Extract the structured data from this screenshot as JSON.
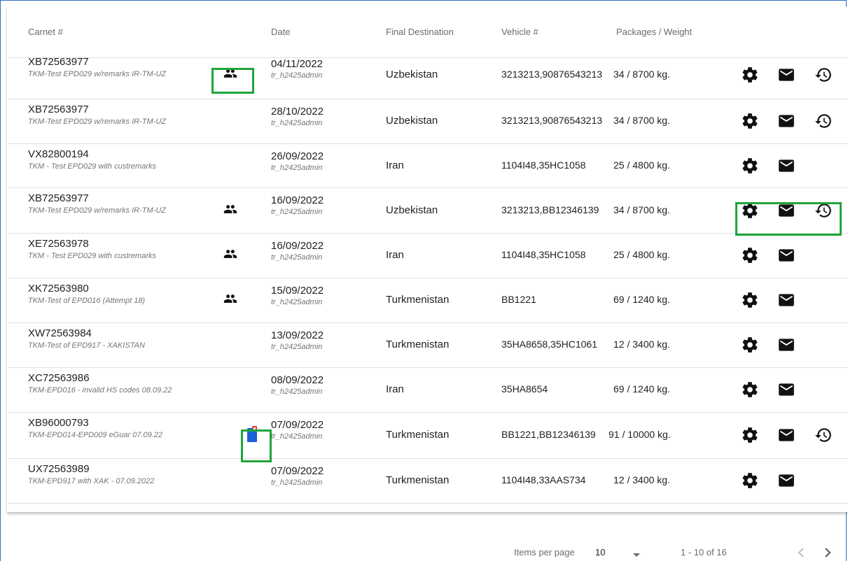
{
  "headers": {
    "carnet": "Carnet #",
    "date": "Date",
    "destination": "Final Destination",
    "vehicle": "Vehicle #",
    "packages": "Packages / Weight"
  },
  "rows": [
    {
      "carnet": "XB72563977",
      "remarks": "TKM-Test EPD029 w/remarks IR-TM-UZ",
      "date": "04/11/2022",
      "user": "tr_h2425admin",
      "destination": "Uzbekistan",
      "vehicle": "3213213,90876543213",
      "packages": "34 / 8700 kg.",
      "badge": "group-icon",
      "history": true
    },
    {
      "carnet": "XB72563977",
      "remarks": "TKM-Test EPD029 w/remarks IR-TM-UZ",
      "date": "28/10/2022",
      "user": "tr_h2425admin",
      "destination": "Uzbekistan",
      "vehicle": "3213213,90876543213",
      "packages": "34 / 8700 kg.",
      "badge": "",
      "history": true
    },
    {
      "carnet": "VX82800194",
      "remarks": "TKM - Test EPD029 with custremarks",
      "date": "26/09/2022",
      "user": "tr_h2425admin",
      "destination": "Iran",
      "vehicle": "1104I48,35HC1058",
      "packages": "25 / 4800 kg.",
      "badge": "",
      "history": false
    },
    {
      "carnet": "XB72563977",
      "remarks": "TKM-Test EPD029 w/remarks IR-TM-UZ",
      "date": "16/09/2022",
      "user": "tr_h2425admin",
      "destination": "Uzbekistan",
      "vehicle": "3213213,BB12346139",
      "packages": "34 / 8700 kg.",
      "badge": "group-icon",
      "history": true
    },
    {
      "carnet": "XE72563978",
      "remarks": "TKM - Test EPD029 with custremarks",
      "date": "16/09/2022",
      "user": "tr_h2425admin",
      "destination": "Iran",
      "vehicle": "1104I48,35HC1058",
      "packages": "25 / 4800 kg.",
      "badge": "group-icon",
      "history": false
    },
    {
      "carnet": "XK72563980",
      "remarks": "TKM-Test of EPD016 (Attempt 18)",
      "date": "15/09/2022",
      "user": "tr_h2425admin",
      "destination": "Turkmenistan",
      "vehicle": "BB1221",
      "packages": "69 / 1240 kg.",
      "badge": "group-icon",
      "history": false
    },
    {
      "carnet": "XW72563984",
      "remarks": "TKM-Test of EPD917 - XAKISTAN",
      "date": "13/09/2022",
      "user": "tr_h2425admin",
      "destination": "Turkmenistan",
      "vehicle": "35HA8658,35HC1061",
      "packages": "12 / 3400 kg.",
      "badge": "",
      "history": false
    },
    {
      "carnet": "XC72563986",
      "remarks": "TKM-EPD016 - invalid HS codes 08.09.22",
      "date": "08/09/2022",
      "user": "tr_h2425admin",
      "destination": "Iran",
      "vehicle": "35HA8654",
      "packages": "69 / 1240 kg.",
      "badge": "",
      "history": false
    },
    {
      "carnet": "XB96000793",
      "remarks": "TKM-EPD014-EPD009 eGuar 07.09.22",
      "date": "07/09/2022",
      "user": "tr_h2425admin",
      "destination": "Turkmenistan",
      "vehicle": "BB1221,BB12346139",
      "packages": "91 / 10000 kg.",
      "badge": "document-icon",
      "history": true
    },
    {
      "carnet": "UX72563989",
      "remarks": "TKM-EPD917 with XAK - 07.09.2022",
      "date": "07/09/2022",
      "user": "tr_h2425admin",
      "destination": "Turkmenistan",
      "vehicle": "1104I48,33AAS734",
      "packages": "12 / 3400 kg.",
      "badge": "",
      "history": false
    }
  ],
  "pagination": {
    "items_per_page_label": "Items per page",
    "items_per_page_value": "10",
    "range": "1 - 10 of 16"
  },
  "colors": {
    "highlight": "#1ea53a",
    "icon": "#111111",
    "document_blue": "#1f5fd6",
    "document_red": "#e53935"
  }
}
